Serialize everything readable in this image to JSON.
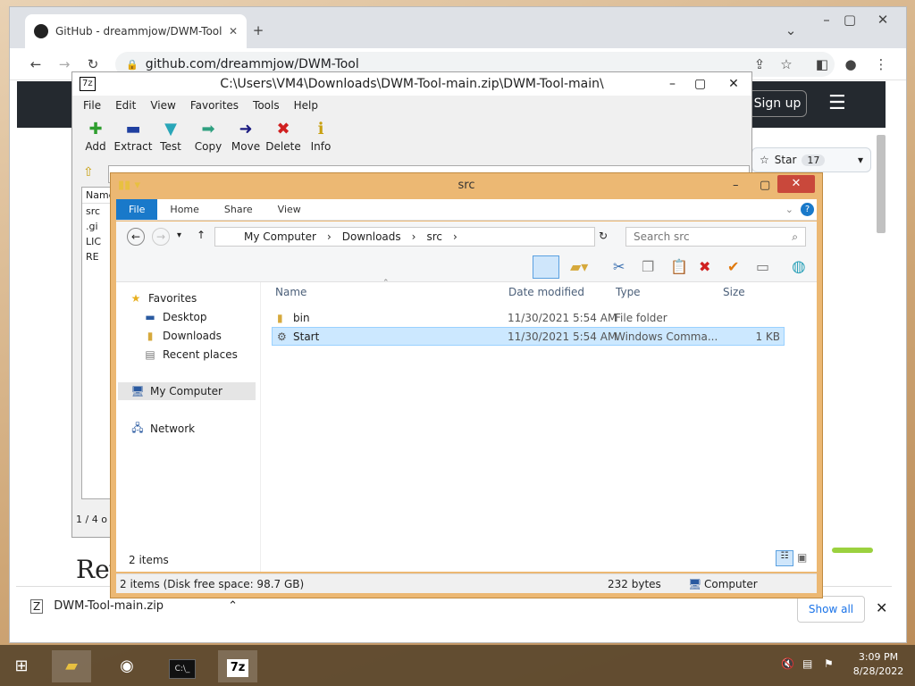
{
  "chrome": {
    "tab_title": "GitHub - dreammjow/DWM-Tool",
    "url": "github.com/dreammjow/DWM-Tool",
    "github": {
      "signup_label": "Sign up",
      "star_label": "Star",
      "star_count": "17",
      "partial_heading": "Rev"
    },
    "download": {
      "filename": "DWM-Tool-main.zip",
      "show_all": "Show all"
    }
  },
  "sevenzip": {
    "title": "C:\\Users\\VM4\\Downloads\\DWM-Tool-main.zip\\DWM-Tool-main\\",
    "menu": [
      "File",
      "Edit",
      "View",
      "Favorites",
      "Tools",
      "Help"
    ],
    "toolbar": [
      {
        "label": "Add",
        "icon": "plus-icon",
        "color": "#2e9e2e"
      },
      {
        "label": "Extract",
        "icon": "minus-icon",
        "color": "#1f3fa0"
      },
      {
        "label": "Test",
        "icon": "check-down-icon",
        "color": "#29a6b8"
      },
      {
        "label": "Copy",
        "icon": "double-arrow-icon",
        "color": "#2fa080"
      },
      {
        "label": "Move",
        "icon": "arrow-right-icon",
        "color": "#1a1a80"
      },
      {
        "label": "Delete",
        "icon": "x-icon",
        "color": "#d02020"
      },
      {
        "label": "Info",
        "icon": "info-icon",
        "color": "#c8a010"
      }
    ],
    "list_header": "Name",
    "list_items": [
      "src",
      ".gi",
      "LIC",
      "RE"
    ],
    "status": "1 / 4 o"
  },
  "explorer": {
    "title": "src",
    "ribbon_tabs": [
      "File",
      "Home",
      "Share",
      "View"
    ],
    "path": [
      "My Computer",
      "Downloads",
      "src"
    ],
    "search_placeholder": "Search src",
    "nav": {
      "favorites": "Favorites",
      "desktop": "Desktop",
      "downloads": "Downloads",
      "recent": "Recent places",
      "computer": "My Computer",
      "network": "Network"
    },
    "columns": [
      "Name",
      "Date modified",
      "Type",
      "Size"
    ],
    "files": [
      {
        "name": "bin",
        "date": "11/30/2021 5:54 AM",
        "type": "File folder",
        "size": "",
        "icon": "folder-icon"
      },
      {
        "name": "Start",
        "date": "11/30/2021 5:54 AM",
        "type": "Windows Comma...",
        "size": "1 KB",
        "icon": "cmd-file-icon"
      }
    ],
    "item_count": "2 items",
    "status_left": "2 items (Disk free space: 98.7 GB)",
    "status_mid": "232 bytes",
    "status_right": "Computer"
  },
  "taskbar": {
    "time": "3:09 PM",
    "date": "8/28/2022",
    "cmd_label": "C:\\_",
    "sevenzip_label": "7z"
  }
}
